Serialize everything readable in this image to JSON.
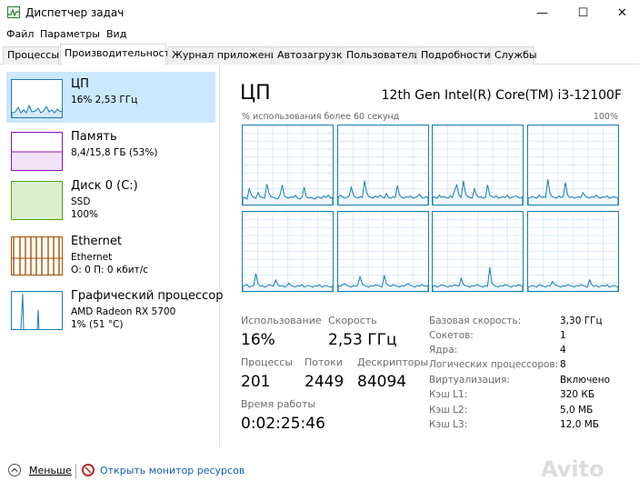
{
  "window": {
    "title": "Диспетчер задач",
    "minimize": "—",
    "maximize": "☐",
    "close": "✕"
  },
  "menu": [
    "Файл",
    "Параметры",
    "Вид"
  ],
  "tabs": [
    "Процессы",
    "Производительность",
    "Журнал приложений",
    "Автозагрузка",
    "Пользователи",
    "Подробности",
    "Службы"
  ],
  "active_tab": "Производительность",
  "sidebar": {
    "items": [
      {
        "name": "ЦП",
        "line1": "16% 2,53 ГГц",
        "line2": "",
        "color": "#117dbb"
      },
      {
        "name": "Память",
        "line1": "8,4/15,8 ГБ (53%)",
        "line2": "",
        "color": "#8b12ae"
      },
      {
        "name": "Диск 0 (C:)",
        "line1": "SSD",
        "line2": "100%",
        "color": "#4da60c"
      },
      {
        "name": "Ethernet",
        "line1": "Ethernet",
        "line2": "О: 0 П: 0 кбит/с",
        "color": "#a74f01"
      },
      {
        "name": "Графический процессор",
        "line1": "AMD Radeon RX 5700",
        "line2": "1% (51 °C)",
        "color": "#117dbb"
      }
    ]
  },
  "main": {
    "title": "ЦП",
    "model": "12th Gen Intel(R) Core(TM) i3-12100F",
    "graph_label": "% использования более 60 секунд",
    "graph_max": "100%",
    "core_count": 8,
    "core_usage": [
      [
        8,
        9,
        7,
        20,
        12,
        9,
        8,
        15,
        10,
        9,
        8,
        26,
        14,
        10,
        9,
        8,
        7,
        12,
        25,
        11,
        9,
        8,
        10,
        9,
        12,
        8,
        7,
        9,
        22,
        10,
        8,
        9,
        8,
        7,
        10,
        9,
        8,
        11,
        9,
        12,
        8,
        9
      ],
      [
        9,
        12,
        10,
        8,
        9,
        11,
        22,
        12,
        9,
        8,
        10,
        9,
        30,
        15,
        10,
        9,
        8,
        11,
        9,
        12,
        10,
        8,
        14,
        9,
        8,
        10,
        9,
        24,
        12,
        9,
        8,
        10,
        9,
        11,
        8,
        9,
        10,
        13,
        9,
        8,
        10,
        9
      ],
      [
        10,
        9,
        8,
        12,
        9,
        10,
        9,
        8,
        11,
        9,
        18,
        25,
        12,
        9,
        30,
        14,
        10,
        9,
        8,
        20,
        12,
        9,
        10,
        8,
        9,
        25,
        12,
        10,
        9,
        11,
        8,
        9,
        10,
        9,
        12,
        8,
        9,
        10,
        11,
        9,
        8,
        10
      ],
      [
        8,
        9,
        10,
        9,
        8,
        12,
        9,
        10,
        9,
        32,
        14,
        10,
        9,
        8,
        11,
        9,
        10,
        28,
        12,
        9,
        10,
        8,
        9,
        10,
        9,
        15,
        11,
        9,
        8,
        10,
        9,
        12,
        9,
        8,
        10,
        9,
        11,
        8,
        9,
        10,
        9,
        8
      ],
      [
        6,
        7,
        8,
        5,
        6,
        7,
        22,
        9,
        6,
        7,
        5,
        6,
        8,
        7,
        6,
        14,
        8,
        6,
        7,
        5,
        6,
        10,
        7,
        6,
        5,
        7,
        6,
        8,
        5,
        6,
        7,
        6,
        5,
        7,
        6,
        8,
        5,
        6,
        7,
        6,
        5,
        6
      ],
      [
        7,
        6,
        8,
        9,
        7,
        6,
        5,
        7,
        6,
        8,
        18,
        9,
        7,
        6,
        5,
        7,
        6,
        8,
        7,
        6,
        5,
        20,
        9,
        7,
        6,
        8,
        7,
        6,
        5,
        7,
        6,
        8,
        9,
        7,
        6,
        5,
        7,
        6,
        8,
        7,
        6,
        7
      ],
      [
        6,
        7,
        5,
        6,
        8,
        7,
        6,
        5,
        7,
        6,
        8,
        7,
        6,
        16,
        8,
        7,
        6,
        5,
        7,
        6,
        8,
        7,
        6,
        5,
        7,
        6,
        30,
        10,
        7,
        6,
        5,
        7,
        6,
        8,
        7,
        6,
        5,
        7,
        6,
        8,
        7,
        6
      ],
      [
        5,
        6,
        7,
        6,
        5,
        8,
        7,
        6,
        5,
        7,
        6,
        12,
        8,
        7,
        6,
        5,
        7,
        6,
        8,
        7,
        6,
        5,
        7,
        6,
        8,
        7,
        6,
        5,
        14,
        8,
        6,
        7,
        5,
        6,
        7,
        6,
        8,
        5,
        6,
        7,
        6,
        5
      ]
    ],
    "stats": {
      "usage_label": "Использование",
      "usage_value": "16%",
      "speed_label": "Скорость",
      "speed_value": "2,53 ГГц",
      "processes_label": "Процессы",
      "processes_value": "201",
      "threads_label": "Потоки",
      "threads_value": "2449",
      "handles_label": "Дескрипторы",
      "handles_value": "84094",
      "uptime_label": "Время работы",
      "uptime_value": "0:02:25:46"
    },
    "specs": [
      {
        "key": "Базовая скорость:",
        "value": "3,30 ГГц"
      },
      {
        "key": "Сокетов:",
        "value": "1"
      },
      {
        "key": "Ядра:",
        "value": "4"
      },
      {
        "key": "Логических процессоров:",
        "value": "8"
      },
      {
        "key": "Виртуализация:",
        "value": "Включено"
      },
      {
        "key": "Кэш L1:",
        "value": "320 КБ"
      },
      {
        "key": "Кэш L2:",
        "value": "5,0 МБ"
      },
      {
        "key": "Кэш L3:",
        "value": "12,0 МБ"
      }
    ]
  },
  "footer": {
    "less": "Меньше",
    "monitor": "Открыть монитор ресурсов"
  },
  "watermark": "Avito",
  "colors": {
    "accent": "#117dbb",
    "selected_bg": "#cce8ff",
    "link": "#1060b0"
  },
  "icons": [
    "task-manager-icon",
    "chevron-up-icon",
    "resource-monitor-icon"
  ]
}
